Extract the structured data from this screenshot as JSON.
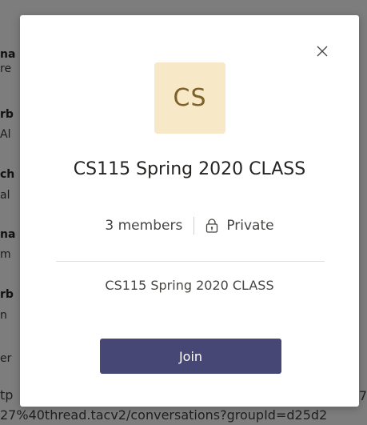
{
  "background": {
    "fragments": [
      "na",
      "re",
      "rb",
      "Al",
      "ch",
      "al",
      "na",
      "m",
      "rb",
      "n",
      "er",
      "tp"
    ],
    "url_line_top": "tp",
    "url_line": "27%40thread.tacv2/conversations?groupId=d25d2",
    "right_char": "7"
  },
  "modal": {
    "avatar_initials": "CS",
    "title": "CS115 Spring 2020 CLASS",
    "members": "3 members",
    "privacy": "Private",
    "description": "CS115 Spring 2020 CLASS",
    "join_label": "Join"
  },
  "colors": {
    "avatar_bg": "#f7e8c8",
    "avatar_text": "#7d6128",
    "join_bg": "#464775"
  },
  "icons": {
    "close": "close-icon",
    "lock": "lock-icon"
  }
}
